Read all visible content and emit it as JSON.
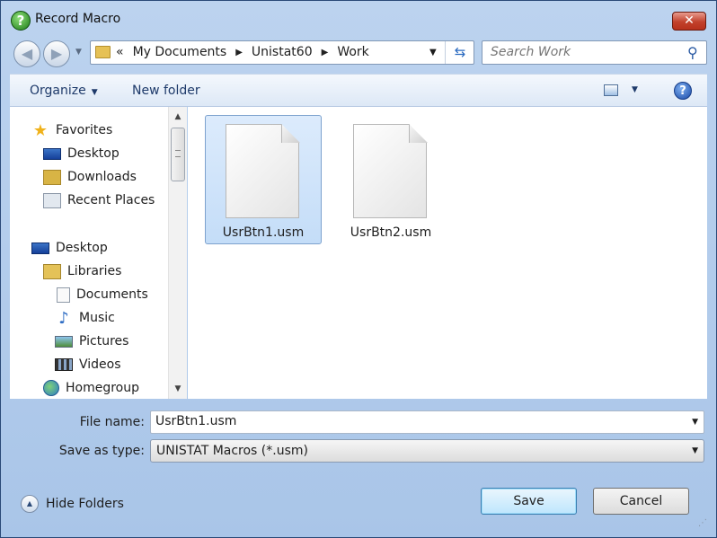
{
  "window": {
    "title": "Record Macro"
  },
  "address": {
    "overflow": "«",
    "crumbs": [
      "My Documents",
      "Unistat60",
      "Work"
    ]
  },
  "search": {
    "placeholder": "Search Work"
  },
  "toolbar": {
    "organize": "Organize",
    "new_folder": "New folder"
  },
  "nav": {
    "favorites": "Favorites",
    "desktop_fav": "Desktop",
    "downloads": "Downloads",
    "recent_places": "Recent Places",
    "desktop": "Desktop",
    "libraries": "Libraries",
    "documents": "Documents",
    "music": "Music",
    "pictures": "Pictures",
    "videos": "Videos",
    "homegroup": "Homegroup"
  },
  "files": [
    {
      "name": "UsrBtn1.usm",
      "selected": true
    },
    {
      "name": "UsrBtn2.usm",
      "selected": false
    }
  ],
  "form": {
    "file_name_label": "File name:",
    "file_name_value": "UsrBtn1.usm",
    "save_type_label": "Save as type:",
    "save_type_value": "UNISTAT Macros (*.usm)"
  },
  "footer": {
    "hide_folders": "Hide Folders",
    "save": "Save",
    "cancel": "Cancel"
  }
}
